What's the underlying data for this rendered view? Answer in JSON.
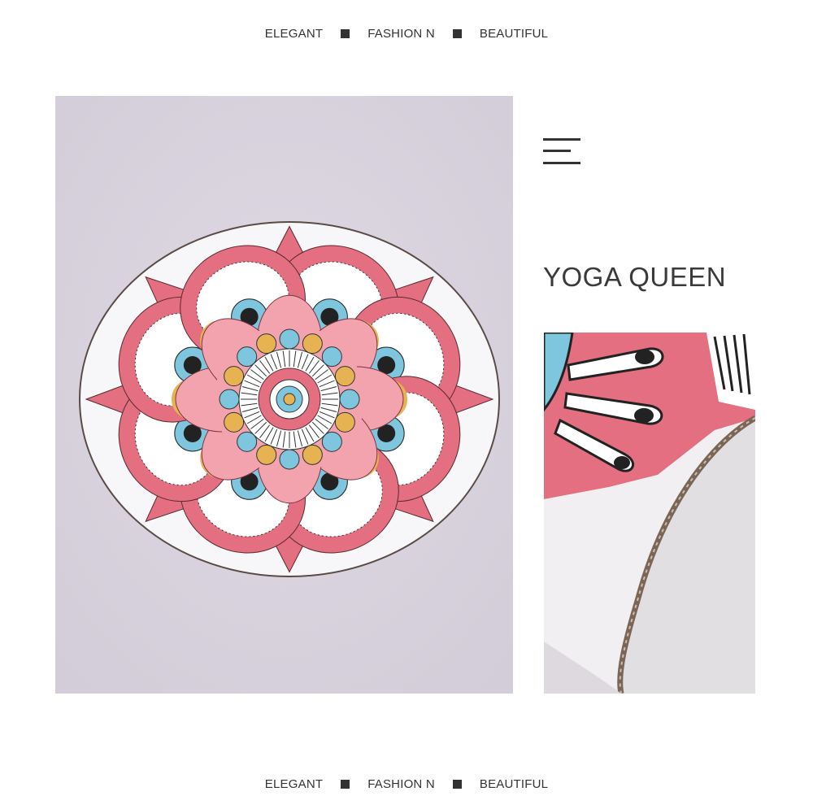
{
  "tagline_top": {
    "word1": "ELEGANT",
    "word2": "FASHION N",
    "word3": "BEAUTIFUL"
  },
  "tagline_bottom": {
    "word1": "ELEGANT",
    "word2": "FASHION N",
    "word3": "BEAUTIFUL"
  },
  "product": {
    "title": "YOGA QUEEN"
  },
  "icons": {
    "menu": "menu-icon",
    "separator": "square-bullet-icon"
  },
  "colors": {
    "text": "#333333",
    "mandala_pink": "#e36f80",
    "mandala_light_pink": "#f3a3ad",
    "mandala_blue": "#7ec5de",
    "mandala_gold": "#e7b352",
    "background_lilac": "#d9d3df"
  }
}
